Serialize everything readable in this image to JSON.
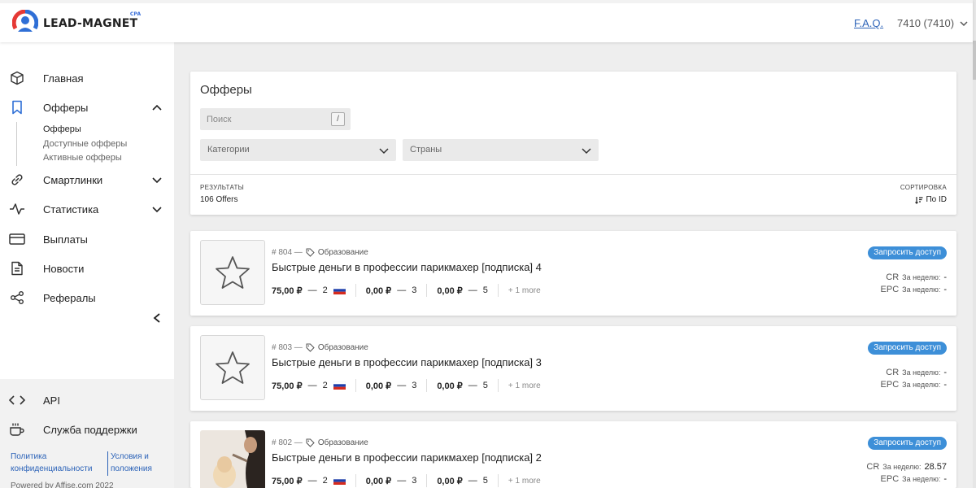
{
  "header": {
    "logo_text": "LEAD-MAGNET",
    "logo_badge": "CPA",
    "faq_label": "F.A.Q.",
    "balance": "7410 (7410)"
  },
  "sidebar": {
    "items": [
      {
        "label": "Главная",
        "icon": "cube-icon"
      },
      {
        "label": "Офферы",
        "icon": "bookmark-icon"
      },
      {
        "label": "Смартлинки",
        "icon": "link-icon"
      },
      {
        "label": "Статистика",
        "icon": "activity-icon"
      },
      {
        "label": "Выплаты",
        "icon": "credit-card-icon"
      },
      {
        "label": "Новости",
        "icon": "document-icon"
      },
      {
        "label": "Рефералы",
        "icon": "share-icon"
      }
    ],
    "offers_sub": [
      "Офферы",
      "Доступные офферы",
      "Активные офферы"
    ],
    "bottom": [
      {
        "label": "API",
        "icon": "code-icon"
      },
      {
        "label": "Служба поддержки",
        "icon": "coffee-icon"
      }
    ],
    "footer": {
      "policy_line1": "Политика",
      "policy_line2": "конфиденциальности",
      "terms_line1": "Условия и",
      "terms_line2": "положения",
      "powered": "Powered by Affise.com 2022"
    }
  },
  "filters": {
    "title": "Офферы",
    "search_placeholder": "Поиск",
    "search_shortcut": "/",
    "categories_placeholder": "Категории",
    "countries_placeholder": "Страны",
    "results_label": "РЕЗУЛЬТАТЫ",
    "results_value": "106 Offers",
    "sort_label": "СОРТИРОВКА",
    "sort_value": "По ID"
  },
  "offers": [
    {
      "id": "# 804 —",
      "category": "Образование",
      "title": "Быстрые деньги в профессии парикмахер [подписка] 4",
      "pay1": "75,00 ₽",
      "goal1": "2",
      "pay2": "0,00 ₽",
      "goal2": "3",
      "pay3": "0,00 ₽",
      "goal3": "5",
      "more": "+ 1 more",
      "button": "Запросить доступ",
      "cr_label": "CR",
      "cr_period": "За неделю:",
      "cr_value": "-",
      "epc_label": "EPC",
      "epc_period": "За неделю:",
      "epc_value": "-"
    },
    {
      "id": "# 803 —",
      "category": "Образование",
      "title": "Быстрые деньги в профессии парикмахер [подписка] 3",
      "pay1": "75,00 ₽",
      "goal1": "2",
      "pay2": "0,00 ₽",
      "goal2": "3",
      "pay3": "0,00 ₽",
      "goal3": "5",
      "more": "+ 1 more",
      "button": "Запросить доступ",
      "cr_label": "CR",
      "cr_period": "За неделю:",
      "cr_value": "-",
      "epc_label": "EPC",
      "epc_period": "За неделю:",
      "epc_value": "-"
    },
    {
      "id": "# 802 —",
      "category": "Образование",
      "title": "Быстрые деньги в профессии парикмахер [подписка] 2",
      "pay1": "75,00 ₽",
      "goal1": "2",
      "pay2": "0,00 ₽",
      "goal2": "3",
      "pay3": "0,00 ₽",
      "goal3": "5",
      "more": "+ 1 more",
      "button": "Запросить доступ",
      "cr_label": "CR",
      "cr_period": "За неделю:",
      "cr_value": "28.57",
      "epc_label": "EPC",
      "epc_period": "За неделю:",
      "epc_value": "-"
    }
  ],
  "colors": {
    "accent": "#3d8fd8",
    "link": "#2c63b8",
    "logo_red": "#e53935",
    "logo_blue": "#2f6fd6"
  }
}
